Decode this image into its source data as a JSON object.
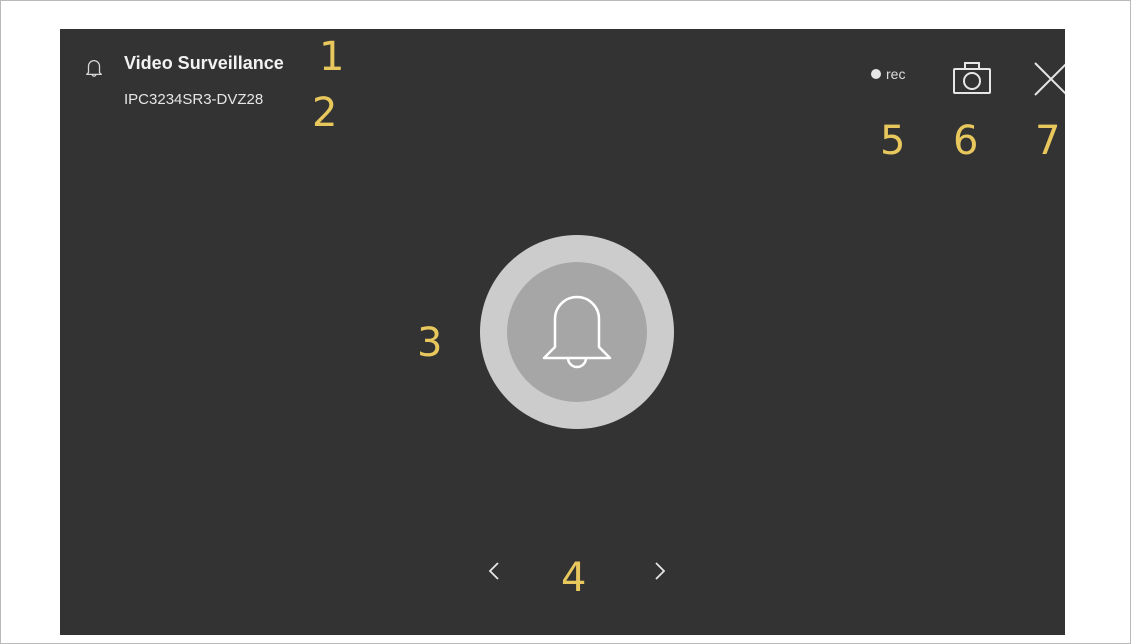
{
  "header": {
    "title": "Video Surveillance",
    "device_name": "IPC3234SR3-DVZ28",
    "icon": "bell-icon"
  },
  "controls": {
    "rec_label": "rec",
    "snapshot_icon": "camera-icon",
    "close_icon": "close-icon"
  },
  "center": {
    "button_icon": "bell-icon"
  },
  "pager": {
    "prev_icon": "chevron-left-icon",
    "next_icon": "chevron-right-icon"
  },
  "callouts": {
    "c1": "1",
    "c2": "2",
    "c3": "3",
    "c4": "4",
    "c5": "5",
    "c6": "6",
    "c7": "7"
  },
  "colors": {
    "screen_background": "#333333",
    "callout": "#e8c85c",
    "button_outer": "#cccccc",
    "button_inner": "#a6a6a6",
    "foreground": "#f2f2f2"
  }
}
